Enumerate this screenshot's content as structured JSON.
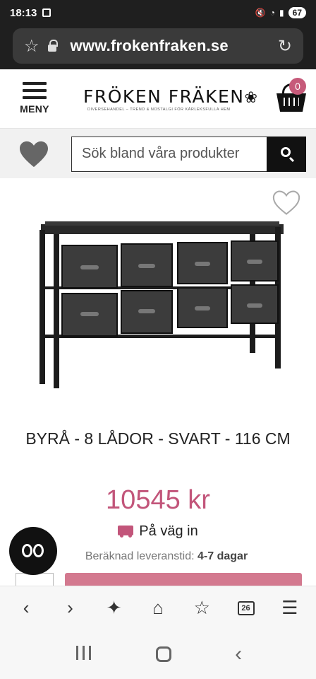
{
  "status_bar": {
    "time": "18:13",
    "battery": "67"
  },
  "browser": {
    "url": "www.frokenfraken.se"
  },
  "header": {
    "menu_label": "MENY",
    "logo_text": "FRÖKEN FRÄKEN",
    "logo_tagline": "DIVERSEHANDEL – TREND & NOSTALGI FÖR KÄRLEKSFULLA HEM",
    "cart_count": "0"
  },
  "search": {
    "placeholder": "Sök bland våra produkter"
  },
  "product": {
    "title": "BYRÅ - 8 LÅDOR - SVART - 116 CM",
    "price": "10545 kr",
    "stock_status": "På väg in",
    "delivery_label": "Beräknad leveranstid:",
    "delivery_value": "4-7 dagar"
  },
  "toolbar_tabs_count": "26",
  "colors": {
    "accent": "#c2557a",
    "button": "#d3798f",
    "dark": "#111111"
  }
}
